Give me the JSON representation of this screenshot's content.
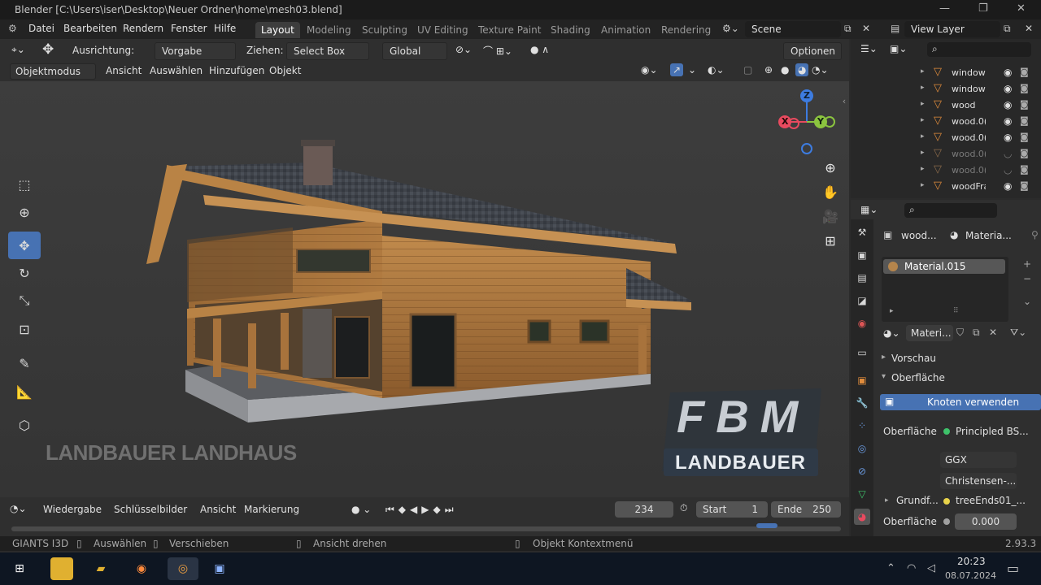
{
  "window": {
    "title": "Blender [C:\\Users\\iser\\Desktop\\Neuer Ordner\\home\\mesh03.blend]",
    "minimize": "—",
    "maximize": "❐",
    "close": "✕"
  },
  "menu": [
    "Datei",
    "Bearbeiten",
    "Rendern",
    "Fenster",
    "Hilfe"
  ],
  "workspaces": [
    "Layout",
    "Modeling",
    "Sculpting",
    "UV Editing",
    "Texture Paint",
    "Shading",
    "Animation",
    "Rendering"
  ],
  "scene": {
    "name": "Scene",
    "view_layer": "View Layer"
  },
  "tool_header": {
    "ausrichtung_label": "Ausrichtung:",
    "ausrichtung_value": "Vorgabe",
    "ziehen_label": "Ziehen:",
    "ziehen_value": "Select Box",
    "transform_value": "Global",
    "optionen": "Optionen"
  },
  "viewport_header": {
    "mode": "Objektmodus",
    "items": [
      "Ansicht",
      "Auswählen",
      "Hinzufügen",
      "Objekt"
    ]
  },
  "gizmo": {
    "z": "Z",
    "y": "Y",
    "x": "X"
  },
  "scene_text": {
    "caption": "LANDBAUER LANDHAUS",
    "logo_top": "FBM",
    "logo_bottom": "LANDBAUER"
  },
  "timeline": {
    "items": [
      "Wiedergabe",
      "Schlüsselbilder",
      "Ansicht",
      "Markierung"
    ],
    "current_frame": "234",
    "start_label": "Start",
    "start_value": "1",
    "end_label": "Ende",
    "end_value": "250"
  },
  "statusbar": {
    "app": "GIANTS I3D",
    "select": "Auswählen",
    "move": "Verschieben",
    "rotate_view": "Ansicht drehen",
    "context": "Objekt Kontextmenü",
    "version": "2.93.3"
  },
  "outliner": [
    {
      "name": "window",
      "dim": false
    },
    {
      "name": "window",
      "dim": false
    },
    {
      "name": "wood",
      "dim": false
    },
    {
      "name": "wood.0(",
      "dim": false
    },
    {
      "name": "wood.0(",
      "dim": false
    },
    {
      "name": "wood.0(",
      "dim": true
    },
    {
      "name": "wood.0(",
      "dim": true
    },
    {
      "name": "woodFra",
      "dim": false
    }
  ],
  "properties": {
    "object_name": "wood...",
    "material_tab": "Materia...",
    "material_slot": "Material.015",
    "material_field": "Materi...",
    "vorschau": "Vorschau",
    "oberflaeche": "Oberfläche",
    "use_nodes": "Knoten verwenden",
    "surface_label": "Oberfläche",
    "surface_value": "Principled BS...",
    "distribution": "GGX",
    "subsurface_method": "Christensen-...",
    "base_label": "Grundf...",
    "base_value": "treeEnds01_...",
    "subsurface_label": "Oberfläche",
    "subsurface_value": "0.000"
  },
  "clock": {
    "time": "20:23",
    "date": "08.07.2024"
  },
  "colors": {
    "accent": "#4772b3",
    "x_axis": "#e84a5f",
    "y_axis": "#8bc43f",
    "z_axis": "#3d7ce0",
    "icon_orange": "#e08c3c"
  }
}
